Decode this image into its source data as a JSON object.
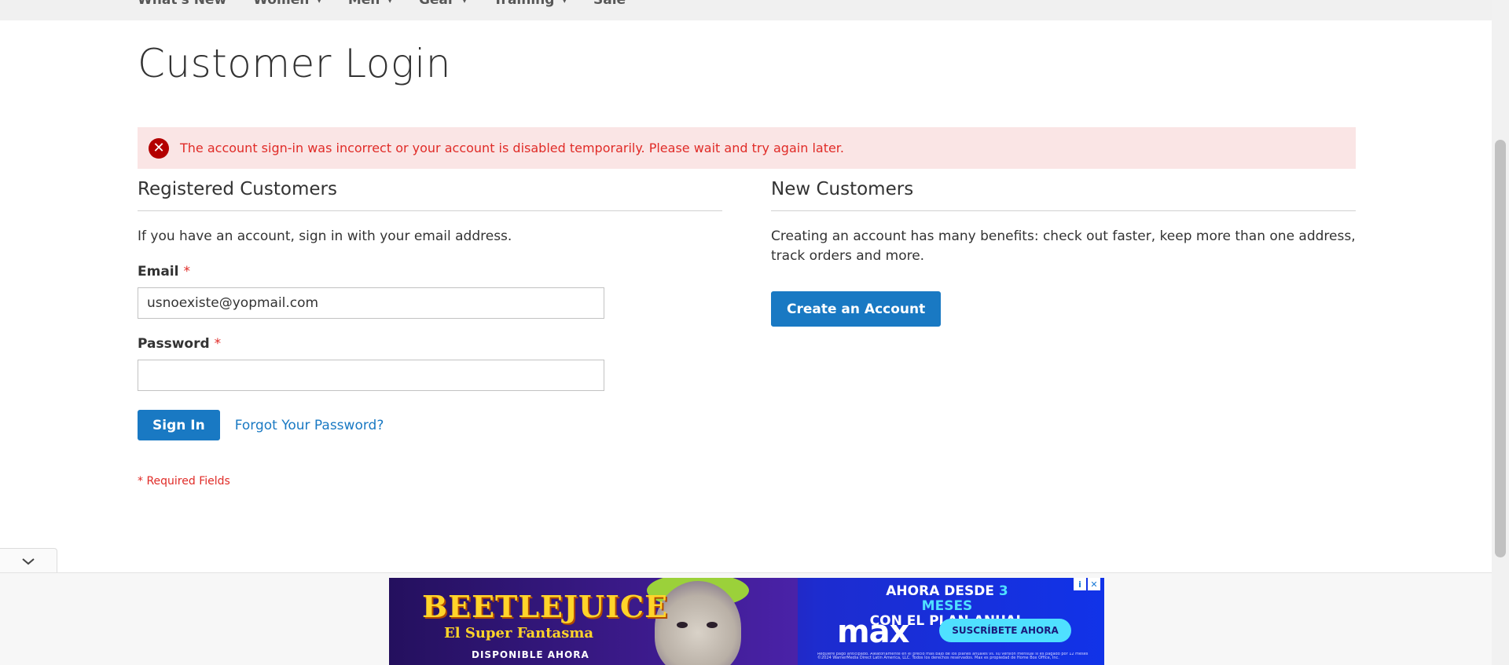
{
  "nav": {
    "items": [
      {
        "label": "What's New",
        "has_caret": false
      },
      {
        "label": "Women",
        "has_caret": true
      },
      {
        "label": "Men",
        "has_caret": true
      },
      {
        "label": "Gear",
        "has_caret": true
      },
      {
        "label": "Training",
        "has_caret": true
      },
      {
        "label": "Sale",
        "has_caret": false
      }
    ]
  },
  "page": {
    "title": "Customer Login"
  },
  "error": {
    "icon": "close-circle-icon",
    "message": "The account sign-in was incorrect or your account is disabled temporarily. Please wait and try again later."
  },
  "registered": {
    "title": "Registered Customers",
    "intro": "If you have an account, sign in with your email address.",
    "email_label": "Email",
    "email_value": "usnoexiste@yopmail.com",
    "password_label": "Password",
    "password_value": "",
    "required_marker": "*",
    "sign_in_label": "Sign In",
    "forgot_label": "Forgot Your Password?",
    "required_note": "* Required Fields"
  },
  "new_customers": {
    "title": "New Customers",
    "intro": "Creating an account has many benefits: check out faster, keep more than one address, track orders and more.",
    "create_label": "Create an Account"
  },
  "ad": {
    "title": "BEETLEJUICE",
    "subtitle": "El Super Fantasma",
    "available": "DISPONIBLE AHORA",
    "headline_prefix": "AHORA DESDE ",
    "headline_highlight": "3 MESES",
    "headline_line2": "CON EL PLAN ANUAL",
    "brand": "max",
    "cta": "SUSCRÍBETE AHORA",
    "info_icon": "info-icon",
    "close_icon": "close-icon",
    "legal": "Requiere pago anticipado. Aleatoriamente en el precio más bajo de los planes anuales vs. su versión mensual si es pagado por 12 meses ©2024 WarnerMedia Direct Latin America, LLC. Todos los derechos reservados. Max es propiedad de Home Box Office, Inc."
  },
  "toggle": {
    "icon": "chevron-down-icon"
  },
  "colors": {
    "primary": "#1979c3",
    "error": "#e02b27",
    "error_bg": "#fae5e5"
  }
}
